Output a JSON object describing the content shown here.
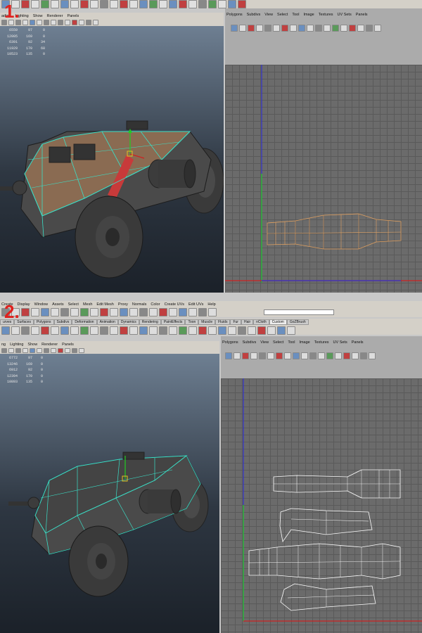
{
  "step1": {
    "number": "1.",
    "panel_menu_left": [
      "ading",
      "Lighting",
      "Show",
      "Renderer",
      "Panels"
    ],
    "panel_menu_right": [
      "Polygons",
      "Subdivs",
      "View",
      "Select",
      "Tool",
      "Image",
      "Textures",
      "UV Sets",
      "Panels"
    ],
    "stats": [
      [
        "6550",
        "97",
        "0"
      ],
      [
        "12005",
        "169",
        "0"
      ],
      [
        "6391",
        "92",
        "34"
      ],
      [
        "11929",
        "170",
        "68"
      ],
      [
        "10523",
        "135",
        "0"
      ]
    ]
  },
  "step2": {
    "number": "2.",
    "main_menu": [
      "Create",
      "Display",
      "Window",
      "Assets",
      "Select",
      "Mesh",
      "Edit Mesh",
      "Proxy",
      "Normals",
      "Color",
      "Create UVs",
      "Edit UVs",
      "Help"
    ],
    "shelf_tabs": [
      "urves",
      "Surfaces",
      "Polygons",
      "Subdivs",
      "Deformation",
      "Animation",
      "Dynamics",
      "Rendering",
      "PaintEffects",
      "Toon",
      "Muscle",
      "Fluids",
      "Fur",
      "Hair",
      "nCloth",
      "Custom",
      "GoZBrush"
    ],
    "active_shelf_tab": "Custom",
    "panel_menu_left": [
      "ng",
      "Lighting",
      "Show",
      "Renderer",
      "Panels"
    ],
    "panel_menu_right": [
      "Polygons",
      "Subdivs",
      "View",
      "Select",
      "Tool",
      "Image",
      "Textures",
      "UV Sets",
      "Panels"
    ],
    "stats": [
      [
        "6772",
        "97",
        "0"
      ],
      [
        "13246",
        "169",
        "0"
      ],
      [
        "6912",
        "92",
        "0"
      ],
      [
        "12394",
        "170",
        "0"
      ],
      [
        "10893",
        "135",
        "0"
      ]
    ]
  },
  "colors": {
    "step_number": "#e0211d",
    "selection_wire": "#3ae0c8",
    "uv_selected": "#e0a060",
    "uv_wire": "#ffffff",
    "uv_axis_v": "#3333cc",
    "uv_axis_u": "#cc2222"
  }
}
